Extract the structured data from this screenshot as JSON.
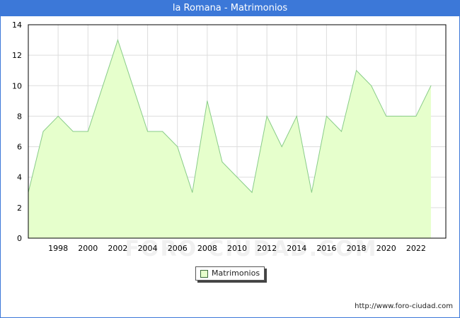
{
  "header": {
    "title": "la Romana - Matrimonios"
  },
  "watermark": "FORO-CIUDAD.COM",
  "source_url": "http://www.foro-ciudad.com",
  "colors": {
    "title_bar": "#3c78d8",
    "area_fill": "#e6ffcc",
    "line": "#88cc88",
    "grid": "#dddddd",
    "axis": "#000000"
  },
  "chart_data": {
    "type": "area",
    "title": "la Romana - Matrimonios",
    "xlabel": "",
    "ylabel": "",
    "xlim": [
      1996,
      2024
    ],
    "ylim": [
      0,
      14
    ],
    "x_ticks": [
      1998,
      2000,
      2002,
      2004,
      2006,
      2008,
      2010,
      2012,
      2014,
      2016,
      2018,
      2020,
      2022
    ],
    "y_ticks": [
      0,
      2,
      4,
      6,
      8,
      10,
      12,
      14
    ],
    "grid": true,
    "legend_position": "bottom-center",
    "series": [
      {
        "name": "Matrimonios",
        "x": [
          1996,
          1997,
          1998,
          1999,
          2000,
          2001,
          2002,
          2003,
          2004,
          2005,
          2006,
          2007,
          2008,
          2009,
          2010,
          2011,
          2012,
          2013,
          2014,
          2015,
          2016,
          2017,
          2018,
          2019,
          2020,
          2021,
          2022,
          2023
        ],
        "values": [
          3,
          7,
          8,
          7,
          7,
          10,
          13,
          10,
          7,
          7,
          6,
          3,
          9,
          5,
          4,
          3,
          8,
          6,
          8,
          3,
          8,
          7,
          11,
          10,
          8,
          8,
          8,
          10
        ]
      }
    ]
  }
}
